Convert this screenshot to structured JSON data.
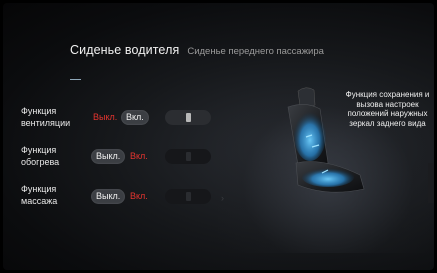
{
  "tabs": {
    "driver_seat": "Сиденье водителя",
    "passenger_seat": "Сиденье переднего пассажира"
  },
  "rows": [
    {
      "label": "Функция\nвентиляции",
      "off": "Выкл.",
      "on": "Вкл.",
      "selected": "on"
    },
    {
      "label": "Функция\nобогрева",
      "off": "Выкл.",
      "on": "Вкл.",
      "selected": "off"
    },
    {
      "label": "Функция\nмассажа",
      "off": "Выкл.",
      "on": "Вкл.",
      "selected": "off"
    }
  ],
  "info": {
    "text": "Функция сохранения и вызова настроек положений наружных зеркал заднего вида"
  },
  "colors": {
    "accent_red": "#e3342f",
    "pill_bg": "#3b3e43",
    "seat_glow": "#2fa8ff"
  },
  "icons": {
    "seat_mini": "seat-icon",
    "chevron": "chevron-right-icon"
  }
}
